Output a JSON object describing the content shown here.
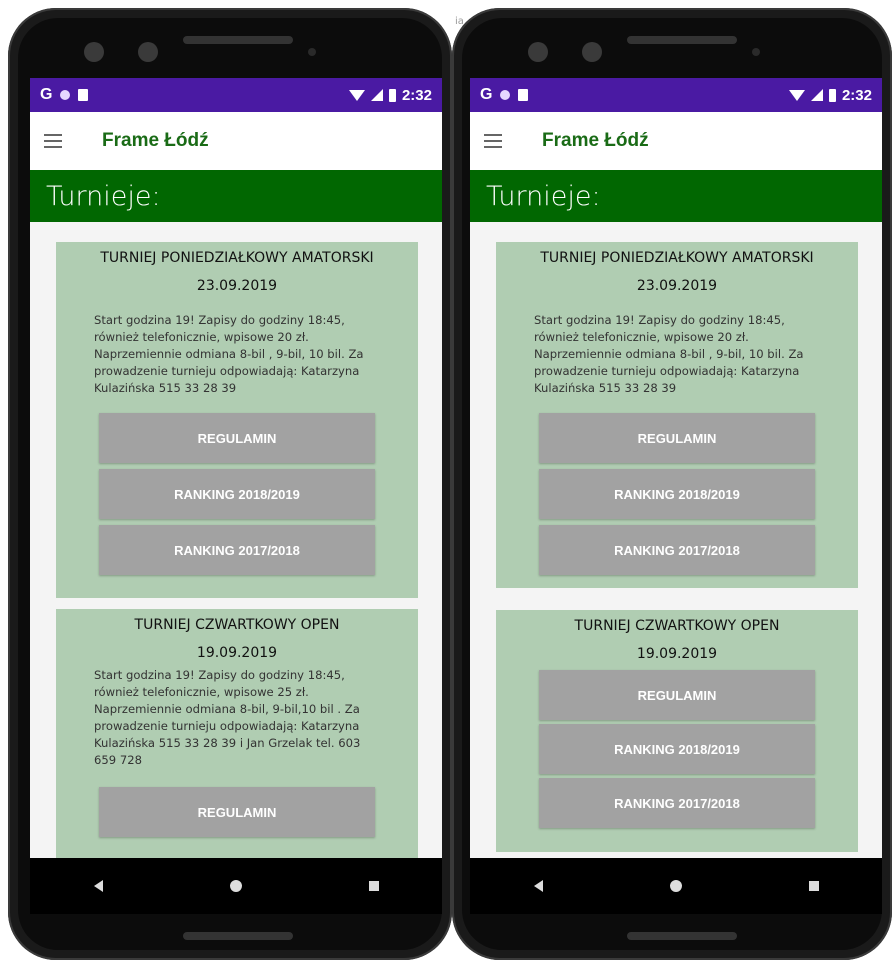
{
  "background": {
    "text": "ia"
  },
  "status_bar": {
    "time": "2:32",
    "g_letter": "G"
  },
  "app": {
    "title": "Frame Łódź"
  },
  "header": {
    "title": "Turnieje:"
  },
  "left_screen": {
    "card1": {
      "title": "TURNIEJ PONIEDZIAŁKOWY AMATORSKI",
      "date": "23.09.2019",
      "description": "Start godzina 19! Zapisy do godziny 18:45, również telefonicznie, wpisowe 20 zł. Naprzemiennie odmiana 8-bil , 9-bil, 10 bil.  Za prowadzenie turnieju odpowiadają: Katarzyna Kulazińska 515 33 28 39",
      "buttons": [
        "REGULAMIN",
        "RANKING 2018/2019",
        "RANKING 2017/2018"
      ]
    },
    "card2": {
      "title": "TURNIEJ CZWARTKOWY OPEN",
      "date": "19.09.2019",
      "description": "Start godzina 19! Zapisy do godziny 18:45, również telefonicznie, wpisowe 25 zł. Naprzemiennie odmiana 8-bil, 9-bil,10 bil . Za prowadzenie turnieju odpowiadają: Katarzyna Kulazińska 515 33 28 39 i Jan Grzelak tel. 603 659 728",
      "buttons": [
        "REGULAMIN"
      ]
    }
  },
  "right_screen": {
    "card1": {
      "title": "TURNIEJ PONIEDZIAŁKOWY AMATORSKI",
      "date": "23.09.2019",
      "description": "Start godzina 19! Zapisy do godziny 18:45, również telefonicznie, wpisowe 20 zł. Naprzemiennie odmiana 8-bil , 9-bil, 10 bil.  Za prowadzenie turnieju odpowiadają: Katarzyna Kulazińska 515 33 28 39",
      "buttons": [
        "REGULAMIN",
        "RANKING 2018/2019",
        "RANKING 2017/2018"
      ]
    },
    "card2": {
      "title": "TURNIEJ CZWARTKOWY OPEN",
      "date": "19.09.2019",
      "buttons": [
        "REGULAMIN",
        "RANKING 2018/2019",
        "RANKING 2017/2018"
      ]
    }
  },
  "colors": {
    "status_bar": "#4a1aa3",
    "header": "#016701",
    "title_green": "#1a6b16",
    "card": "#b0cdb2",
    "button": "#a2a2a2"
  },
  "icons": [
    "menu-icon",
    "wifi-icon",
    "signal-icon",
    "battery-icon",
    "back-icon",
    "home-icon",
    "recents-icon"
  ]
}
